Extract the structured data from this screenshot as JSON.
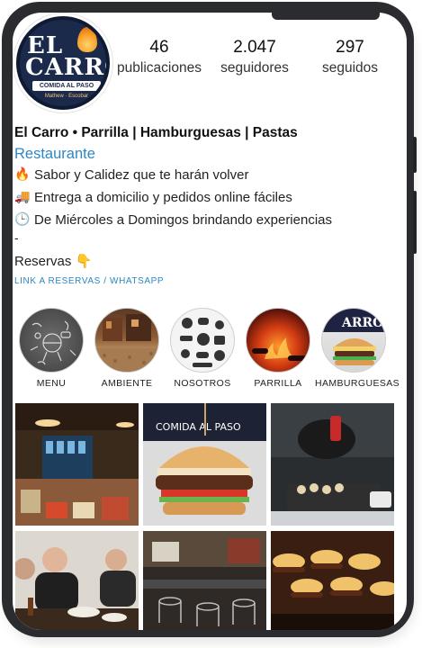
{
  "profile": {
    "logo_text_1": "EL",
    "logo_text_2": "CARRO",
    "logo_ribbon": "COMIDA AL PASO",
    "logo_sub": "Mathew · Escobar",
    "stats": [
      {
        "value": "46",
        "label": "publicaciones"
      },
      {
        "value": "2.047",
        "label": "seguidores"
      },
      {
        "value": "297",
        "label": "seguidos"
      }
    ],
    "name": "El Carro • Parrilla | Hamburguesas | Pastas",
    "category": "Restaurante",
    "bio_lines": [
      {
        "emoji": "🔥",
        "text": "Sabor y Calidez que te harán volver"
      },
      {
        "emoji": "🚚",
        "text": "Entrega a domicilio y pedidos online fáciles"
      },
      {
        "emoji": "🕒",
        "text": "De Miércoles a Domingos brindando experiencias"
      }
    ],
    "dash": "-",
    "reservas": "Reservas 👇",
    "link": "LINK A RESERVAS / WHATSAPP"
  },
  "highlights": [
    {
      "label": "MENU",
      "icon": "grill-doodle-icon"
    },
    {
      "label": "AMBIENTE",
      "icon": "outdoor-terrace-icon"
    },
    {
      "label": "NOSOTROS",
      "icon": "food-doodle-icon"
    },
    {
      "label": "PARRILLA",
      "icon": "fire-grill-icon"
    },
    {
      "label": "HAMBURGUESAS",
      "icon": "burger-icon"
    }
  ],
  "posts": [
    {
      "name": "post-bar-interior"
    },
    {
      "name": "post-burger-closeup"
    },
    {
      "name": "post-chef-plating"
    },
    {
      "name": "post-friends-eating"
    },
    {
      "name": "post-restaurant-tables"
    },
    {
      "name": "post-grill-burgers"
    }
  ],
  "colors": {
    "link": "#2d87c4",
    "frame": "#2b2c2f",
    "logo_navy": "#1b2a4a"
  }
}
